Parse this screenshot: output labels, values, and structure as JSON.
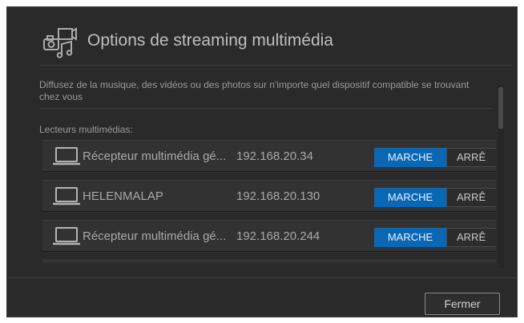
{
  "dialog": {
    "title": "Options de streaming multimédia",
    "icon": "media-streaming-icon",
    "description": "Diffusez de la musique, des vidéos ou des photos sur n'importe quel dispositif compatible se trouvant chez vous",
    "section_label": "Lecteurs multimédias:",
    "players": [
      {
        "name": "Récepteur multimédia gé...",
        "ip": "192.168.20.34",
        "on_label": "MARCHE",
        "off_label": "ARRÊ",
        "state": "on"
      },
      {
        "name": "HELENMALAP",
        "ip": "192.168.20.130",
        "on_label": "MARCHE",
        "off_label": "ARRÊ",
        "state": "on"
      },
      {
        "name": "Récepteur multimédia gé...",
        "ip": "192.168.20.244",
        "on_label": "MARCHE",
        "off_label": "ARRÊ",
        "state": "on"
      },
      {
        "name": "",
        "ip": "",
        "on_label": "",
        "off_label": "",
        "state": "on"
      }
    ],
    "close_label": "Fermer"
  },
  "colors": {
    "dialog_bg": "#2a2a2a",
    "row_bg": "#323232",
    "accent": "#0a67b4",
    "text": "#a8a8a8"
  }
}
